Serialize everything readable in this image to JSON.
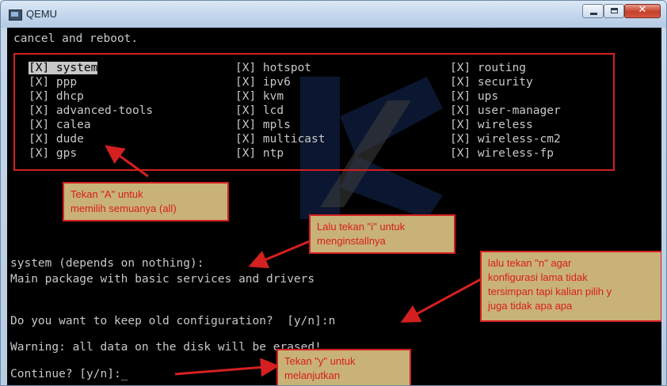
{
  "window": {
    "title": "QEMU",
    "close_glyph": "✕"
  },
  "terminal": {
    "header_line": "cancel and reboot.",
    "packages": [
      [
        "[X] system",
        "[X] ppp",
        "[X] dhcp",
        "[X] advanced-tools",
        "[X] calea",
        "[X] dude",
        "[X] gps"
      ],
      [
        "[X] hotspot",
        "[X] ipv6",
        "[X] kvm",
        "[X] lcd",
        "[X] mpls",
        "[X] multicast",
        "[X] ntp"
      ],
      [
        "[X] routing",
        "[X] security",
        "[X] ups",
        "[X] user-manager",
        "[X] wireless",
        "[X] wireless-cm2",
        "[X] wireless-fp"
      ]
    ],
    "dep_line": "system (depends on nothing):",
    "desc_line": "Main package with basic services and drivers",
    "keep_prompt": "Do you want to keep old configuration?  [y/n]:n",
    "warning": "Warning: all data on the disk will be erased!",
    "continue_prompt": "Continue? [y/n]:_"
  },
  "annotations": {
    "a": [
      "Tekan \"A\" untuk",
      "memilih semuanya (all)"
    ],
    "i": [
      "Lalu tekan \"i\" untuk",
      "menginstallnya"
    ],
    "n": [
      "lalu tekan \"n\" agar",
      "konfigurasi lama tidak",
      "tersimpan tapi kalian pilih y",
      "juga tidak apa apa"
    ],
    "y": [
      "Tekan \"y\" untuk",
      "melanjutkan"
    ]
  },
  "colors": {
    "annotation_border": "#d42020",
    "annotation_fill": "#c9b277",
    "terminal_text": "#c8c8c8"
  }
}
